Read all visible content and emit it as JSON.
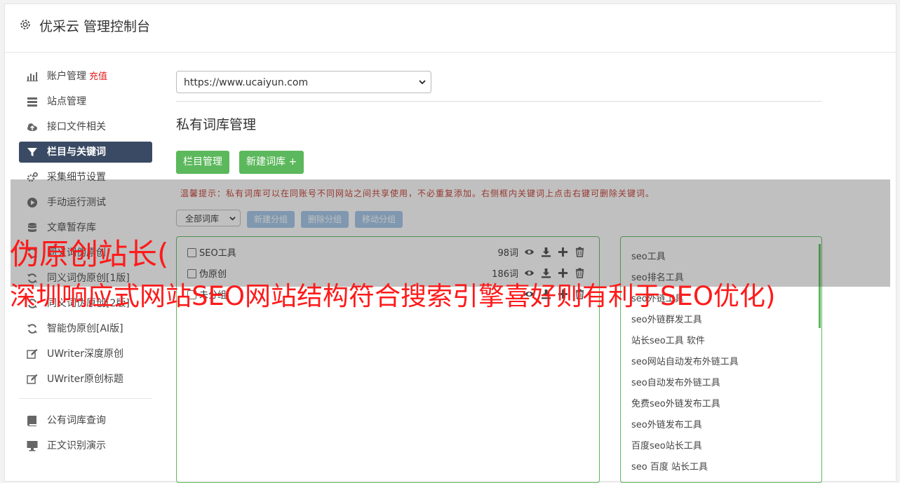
{
  "app": {
    "title": "优采云 管理控制台"
  },
  "sidebar": {
    "items": [
      {
        "label": "账户管理",
        "extra": "充值",
        "icon": "bar-chart-icon"
      },
      {
        "label": "站点管理",
        "icon": "server-icon"
      },
      {
        "label": "接口文件相关",
        "icon": "cloud-upload-icon"
      },
      {
        "label": "栏目与关键词",
        "icon": "filter-icon",
        "active": true
      },
      {
        "label": "采集细节设置",
        "icon": "cogs-icon"
      },
      {
        "label": "手动运行测试",
        "icon": "play-circle-icon"
      },
      {
        "label": "文章暂存库",
        "icon": "database-icon"
      },
      {
        "label": "同义词伪原创",
        "icon": "refresh-icon"
      },
      {
        "label": "同义词伪原创[1版]",
        "icon": "refresh-icon"
      },
      {
        "label": "同义词伪原创[2版]",
        "icon": "refresh-icon"
      },
      {
        "label": "智能伪原创[AI版]",
        "icon": "refresh-icon"
      },
      {
        "label": "UWriter深度原创",
        "icon": "edit-icon"
      },
      {
        "label": "UWriter原创标题",
        "icon": "edit-icon"
      }
    ],
    "items2": [
      {
        "label": "公有词库查询",
        "icon": "book-icon"
      },
      {
        "label": "正文识别演示",
        "icon": "monitor-icon"
      }
    ]
  },
  "main": {
    "site_select": "https://www.ucaiyun.com",
    "page_title": "私有词库管理",
    "btn_columns": "栏目管理",
    "btn_new_library": "新建词库 +",
    "tip": "温馨提示：私有词库可以在同账号不同网站之间共享使用，不必重复添加。右侧框内关键词上点击右键可删除关键词。",
    "library_select": "全部词库",
    "btn_new_group": "新建分组",
    "btn_delete_group": "删除分组",
    "btn_move_group": "移动分组",
    "groups": [
      {
        "name": "SEO工具",
        "count": "98词"
      },
      {
        "name": "伪原创",
        "count": "186词"
      },
      {
        "name": "未分组",
        "count": ""
      }
    ],
    "keywords": [
      "seo工具",
      "seo排名工具",
      "seo外链工具",
      "seo外链群发工具",
      "站长seo工具 软件",
      "seo网站自动发布外链工具",
      "seo自动发布外链工具",
      "免费seo外链发布工具",
      "seo外链发布工具",
      "百度seo站长工具",
      "seo 百度 站长工具"
    ]
  },
  "overlay": {
    "line1": "伪原创站长(",
    "line2": "深圳响应式网站SEO网站结构符合搜索引擎喜好则有利于SEO优化)"
  },
  "colors": {
    "accent_green": "#5cb85c",
    "active_nav": "#3a4a64",
    "overlay_text": "#ff1a1a",
    "tip_text": "#c0392b"
  }
}
